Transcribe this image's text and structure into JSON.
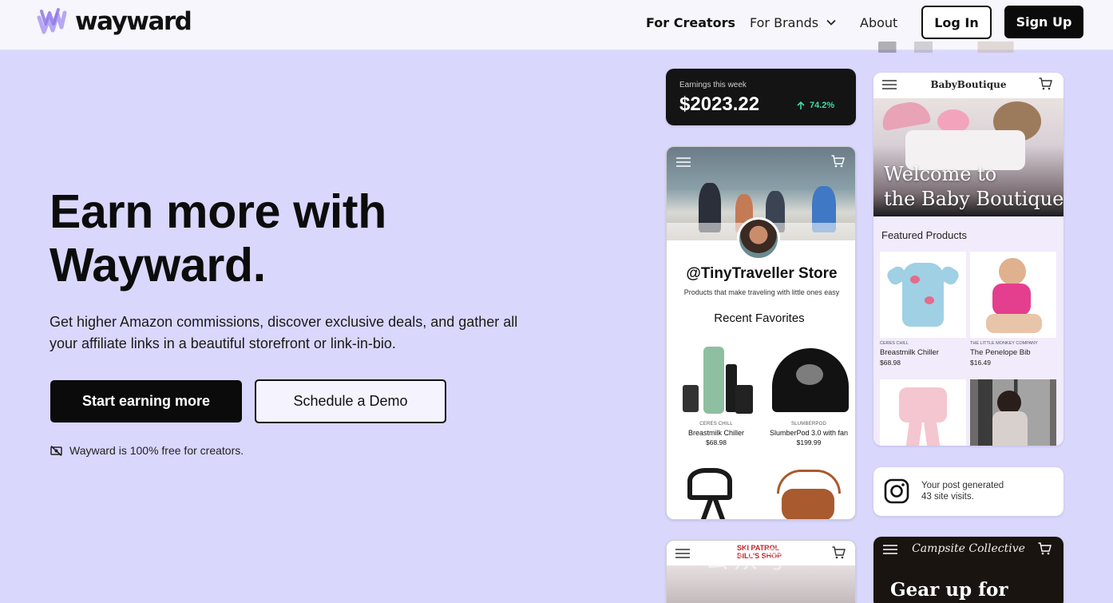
{
  "header": {
    "brand": "wayward",
    "nav": {
      "creators": "For Creators",
      "brands": "For Brands",
      "about": "About"
    },
    "login_label": "Log In",
    "signup_label": "Sign Up"
  },
  "hero": {
    "title_line1": "Earn more with",
    "title_line2": "Wayward.",
    "subtitle": "Get higher Amazon commissions, discover exclusive deals, and gather all your affiliate links in a beautiful storefront or link-in-bio.",
    "primary_cta": "Start earning more",
    "secondary_cta": "Schedule a Demo",
    "free_note": "Wayward is 100% free for creators."
  },
  "earnings_card": {
    "label": "Earnings this week",
    "amount": "$2023.22",
    "change": "74.2%",
    "change_color": "#3ddba7"
  },
  "tiny_traveller": {
    "handle": "@TinyTraveller Store",
    "tagline": "Products that make traveling with little ones easy",
    "section_title": "Recent Favorites",
    "products": [
      {
        "brand": "CERES CHILL",
        "name": "Breastmilk Chiller",
        "price": "$68.98"
      },
      {
        "brand": "SLUMBERPOD",
        "name": "SlumberPod 3.0 with fan",
        "price": "$199.99"
      }
    ]
  },
  "baby_boutique": {
    "store_name": "BabyBoutique",
    "hero_line1": "Welcome to",
    "hero_line2": "the Baby Boutique",
    "section_title": "Featured Products",
    "products": [
      {
        "brand": "CERES CHILL",
        "name": "Breastmilk Chiller",
        "price": "$68.98"
      },
      {
        "brand": "THE LITTLE MONKEY COMPANY",
        "name": "The Penelope Bib",
        "price": "$16.49"
      }
    ]
  },
  "instagram_card": {
    "line1": "Your post generated",
    "line2": "43 site visits."
  },
  "ski_card": {
    "logo_line1": "SKI PATROL",
    "logo_line2": "BILL'S SHOP"
  },
  "campsite_card": {
    "title": "Campsite Collective",
    "hero": "Gear up for"
  },
  "watermark": "公众号 ·"
}
